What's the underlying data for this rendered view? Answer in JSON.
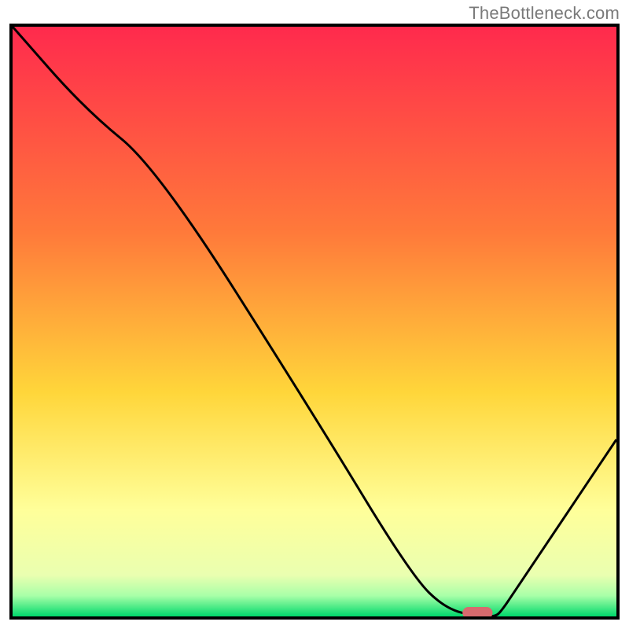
{
  "watermark": "TheBottleneck.com",
  "chart_data": {
    "type": "line",
    "title": "",
    "xlabel": "",
    "ylabel": "",
    "xlim": [
      0,
      100
    ],
    "ylim": [
      0,
      100
    ],
    "grid": false,
    "legend": false,
    "annotations": [],
    "background_gradient_stops": [
      {
        "offset": 0.0,
        "color": "#ff2a4d"
      },
      {
        "offset": 0.35,
        "color": "#ff7a3a"
      },
      {
        "offset": 0.62,
        "color": "#ffd63a"
      },
      {
        "offset": 0.82,
        "color": "#ffff9a"
      },
      {
        "offset": 0.93,
        "color": "#eaffb0"
      },
      {
        "offset": 0.965,
        "color": "#a8ffa8"
      },
      {
        "offset": 1.0,
        "color": "#00d96b"
      }
    ],
    "series": [
      {
        "name": "bottleneck-curve",
        "color": "#000000",
        "x": [
          0,
          12,
          24,
          50,
          66,
          72,
          78,
          80,
          81,
          83,
          100
        ],
        "y": [
          100,
          86,
          76,
          34,
          7,
          1,
          0,
          0,
          1,
          4,
          30
        ]
      }
    ],
    "marker": {
      "name": "optimal-range",
      "color": "#d86a6e",
      "x_start": 74.5,
      "x_end": 79.5,
      "y": 0.6,
      "thickness": 2.0
    }
  }
}
